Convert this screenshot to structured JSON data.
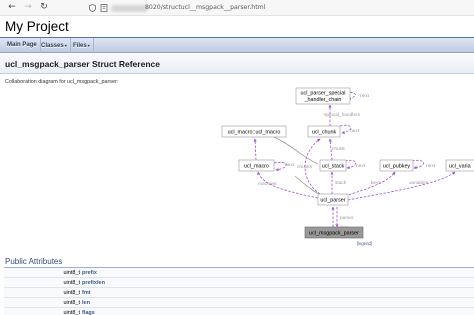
{
  "browser": {
    "back_glyph": "←",
    "forward_glyph": "→",
    "reload_glyph": "↻",
    "url": "8020/structucl__msgpack__parser.html"
  },
  "project_name": "My Project",
  "tabs": [
    {
      "label": "Main Page",
      "has_menu": false
    },
    {
      "label": "Classes",
      "has_menu": true
    },
    {
      "label": "Files",
      "has_menu": true
    }
  ],
  "caret": "▾",
  "page_title": "ucl_msgpack_parser Struct Reference",
  "collab_text": "Collaboration diagram for ucl_msgpack_parser:",
  "diagram": {
    "nodes": {
      "special": [
        "ucl_parser_special",
        "_handler_chain"
      ],
      "macro_ucl_macro": "ucl_macro::ucl_macro",
      "chunk": "ucl_chunk",
      "macro": "ucl_macro",
      "stack": "ucl_stack",
      "pubkey": "ucl_pubkey",
      "variable": "ucl_varia",
      "parser": "ucl_parser",
      "msgpack": "ucl_msgpack_parser"
    },
    "edges": {
      "next_special": "next",
      "special_handlers": "special_handlers",
      "next_chunk": "next",
      "next_pubkey": "next",
      "chunk": "chunk",
      "next_stack": "next",
      "chunks": "chunks",
      "macroes": "macroes",
      "stack": "stack",
      "keys": "keys",
      "variables": "variables",
      "next_macro": "next",
      "parser": "parser",
      "data": "data"
    },
    "colors": {
      "edge": "#a14fd4",
      "edge_gray": "#999999",
      "node_fill": "#ffffff",
      "node_stroke": "#999999",
      "selected_fill": "#999999"
    }
  },
  "legend_label": "[legend]",
  "section_title": "Public Attributes",
  "members": [
    {
      "type": "uint8_t",
      "name": "prefix"
    },
    {
      "type": "uint8_t",
      "name": "prefixlen"
    },
    {
      "type": "uint8_t",
      "name": "fmt"
    },
    {
      "type": "uint8_t",
      "name": "len"
    },
    {
      "type": "uint8_t",
      "name": "flags"
    }
  ]
}
